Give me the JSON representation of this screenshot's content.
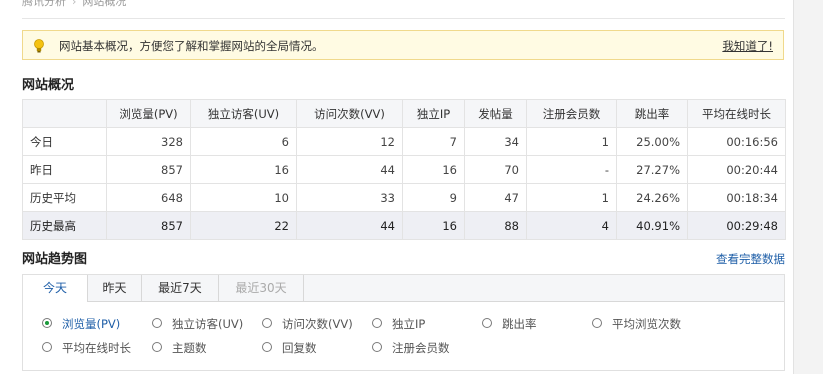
{
  "breadcrumb": [
    "腾讯分析",
    "网站概况"
  ],
  "notice": {
    "text": "网站基本概况，方便您了解和掌握网站的全局情况。",
    "close_label": "我知道了!"
  },
  "overview": {
    "title": "网站概况",
    "columns": [
      "",
      "浏览量(PV)",
      "独立访客(UV)",
      "访问次数(VV)",
      "独立IP",
      "发帖量",
      "注册会员数",
      "跳出率",
      "平均在线时长"
    ],
    "rows": [
      [
        "今日",
        "328",
        "6",
        "12",
        "7",
        "34",
        "1",
        "25.00%",
        "00:16:56"
      ],
      [
        "昨日",
        "857",
        "16",
        "44",
        "16",
        "70",
        "-",
        "27.27%",
        "00:20:44"
      ],
      [
        "历史平均",
        "648",
        "10",
        "33",
        "9",
        "47",
        "1",
        "24.26%",
        "00:18:34"
      ],
      [
        "历史最高",
        "857",
        "22",
        "44",
        "16",
        "88",
        "4",
        "40.91%",
        "00:29:48"
      ]
    ]
  },
  "trend": {
    "title": "网站趋势图",
    "more_label": "查看完整数据",
    "tabs": [
      "今天",
      "昨天",
      "最近7天",
      "最近30天"
    ],
    "active_tab": "今天",
    "metrics": [
      "浏览量(PV)",
      "独立访客(UV)",
      "访问次数(VV)",
      "独立IP",
      "跳出率",
      "平均浏览次数",
      "平均在线时长",
      "主题数",
      "回复数",
      "注册会员数"
    ],
    "selected_metric": "浏览量(PV)"
  },
  "colors": {
    "link": "#1f5fa8",
    "notice_bg": "#fffbe3",
    "notice_border": "#f0d98c",
    "radio_selected": "#1a9a3a"
  }
}
